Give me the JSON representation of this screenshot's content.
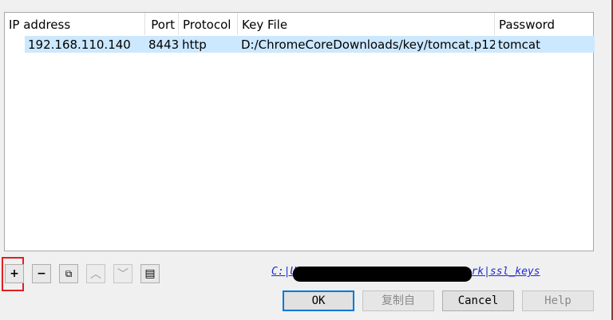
{
  "table": {
    "columns": [
      "IP address",
      "Port",
      "Protocol",
      "Key File",
      "Password"
    ],
    "rows": [
      {
        "ip": "192.168.110.140",
        "port": "8443",
        "protocol": "http",
        "key_file": "D:/ChromeCoreDownloads/key/tomcat.p12",
        "password": "tomcat"
      }
    ]
  },
  "toolbar": {
    "add": "+",
    "remove": "−",
    "copy": "⧉",
    "up": "︿",
    "down": "﹀",
    "clear": "▤"
  },
  "path_link": "C:|Users|...|...|Roaming|Wireshark|ssl_keys",
  "buttons": {
    "ok": "OK",
    "copy_from": "复制自",
    "cancel": "Cancel",
    "help": "Help"
  }
}
